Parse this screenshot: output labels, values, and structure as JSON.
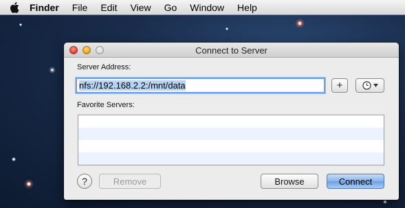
{
  "menubar": {
    "apple_icon": "apple-logo-icon",
    "app_name": "Finder",
    "items": [
      "File",
      "Edit",
      "View",
      "Go",
      "Window",
      "Help"
    ]
  },
  "dialog": {
    "title": "Connect to Server",
    "server_address_label": "Server Address:",
    "server_address_value": "nfs://192.168.2.2:/mnt/data",
    "add_button_label": "+",
    "recent_servers_icon": "clock-icon",
    "favorite_servers_label": "Favorite Servers:",
    "favorite_servers": [],
    "help_button_label": "?",
    "remove_button_label": "Remove",
    "browse_button_label": "Browse",
    "connect_button_label": "Connect"
  },
  "colors": {
    "accent": "#6d9fe2",
    "selection": "#b4d3f5"
  }
}
